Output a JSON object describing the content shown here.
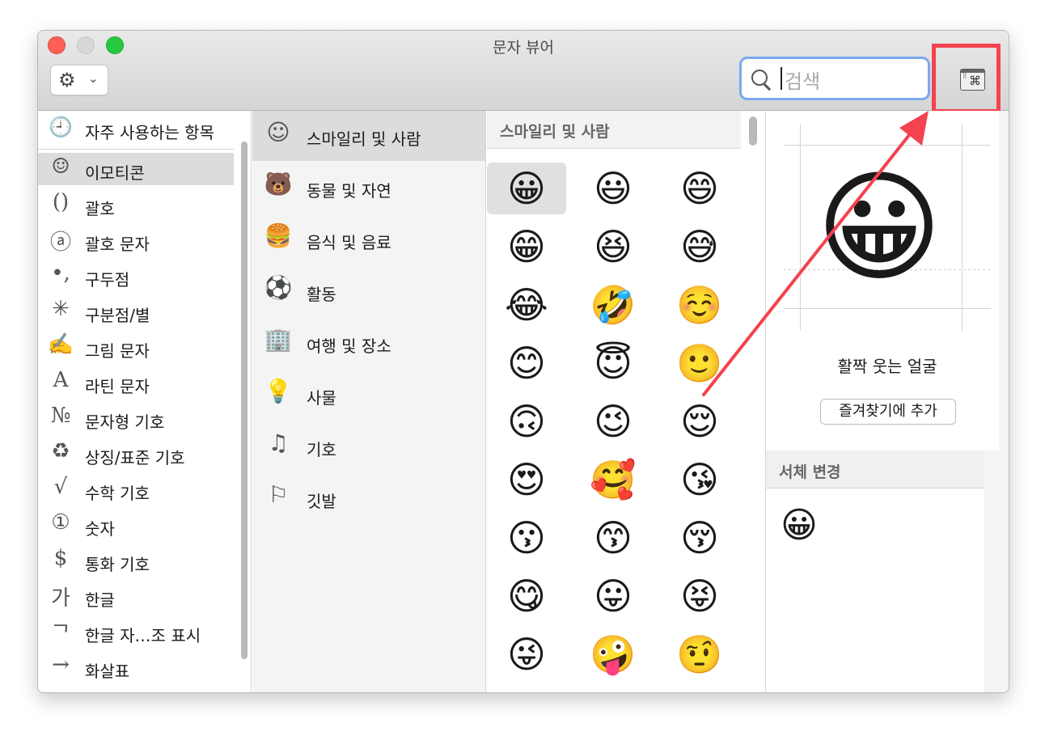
{
  "window": {
    "title": "문자 뷰어"
  },
  "toolbar": {
    "gear": "⚙",
    "chevron": "⌄",
    "search_placeholder": "검색",
    "keyboard_glyph": "⌘"
  },
  "sidebar": {
    "top": {
      "icon": "🕘",
      "label": "자주 사용하는 항목"
    },
    "items": [
      {
        "icon": "☺",
        "label": "이모티콘"
      },
      {
        "icon": "()",
        "label": "괄호"
      },
      {
        "icon": "ⓐ",
        "label": "괄호 문자"
      },
      {
        "icon": "•,",
        "label": "구두점"
      },
      {
        "icon": "✳",
        "label": "구분점/별"
      },
      {
        "icon": "✍",
        "label": "그림 문자"
      },
      {
        "icon": "A",
        "label": "라틴 문자"
      },
      {
        "icon": "№",
        "label": "문자형 기호"
      },
      {
        "icon": "♻",
        "label": "상징/표준 기호"
      },
      {
        "icon": "√",
        "label": "수학 기호"
      },
      {
        "icon": "①",
        "label": "숫자"
      },
      {
        "icon": "$",
        "label": "통화 기호"
      },
      {
        "icon": "가",
        "label": "한글"
      },
      {
        "icon": "ᄀ",
        "label": "한글 자…조 표시"
      },
      {
        "icon": "→",
        "label": "화살표"
      }
    ]
  },
  "categories": [
    {
      "icon": "☺",
      "label": "스마일리 및 사람"
    },
    {
      "icon": "🐻",
      "label": "동물 및 자연"
    },
    {
      "icon": "🍔",
      "label": "음식 및 음료"
    },
    {
      "icon": "⚽",
      "label": "활동"
    },
    {
      "icon": "🏢",
      "label": "여행 및 장소"
    },
    {
      "icon": "💡",
      "label": "사물"
    },
    {
      "icon": "♫",
      "label": "기호"
    },
    {
      "icon": "⚐",
      "label": "깃발"
    }
  ],
  "grid": {
    "header": "스마일리 및 사람",
    "rows": [
      [
        "😀",
        "😃",
        "😄"
      ],
      [
        "😁",
        "😆",
        "😅"
      ],
      [
        "😂",
        "🤣",
        "☺️"
      ],
      [
        "😊",
        "😇",
        "🙂"
      ],
      [
        "🙃",
        "😉",
        "😌"
      ],
      [
        "😍",
        "🥰",
        "😘"
      ],
      [
        "😗",
        "😙",
        "😚"
      ],
      [
        "😋",
        "😛",
        "😝"
      ],
      [
        "😜",
        "🤪",
        "🤨"
      ]
    ]
  },
  "detail": {
    "emoji": "😀",
    "name": "활짝 웃는 얼굴",
    "favorite_button": "즐겨찾기에 추가",
    "font_variation_header": "서체 변경",
    "font_variation": "😀"
  },
  "colors": {
    "highlight": "#f3434e",
    "search_focus": "#7aa9ee"
  }
}
